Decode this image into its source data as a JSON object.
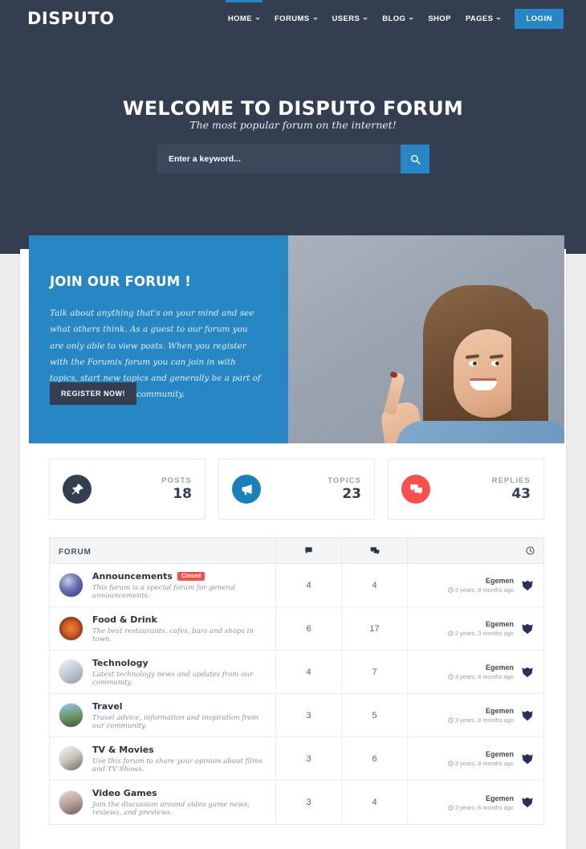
{
  "brand": "DISPUTO",
  "nav": {
    "items": [
      {
        "label": "HOME",
        "caret": true,
        "active": true
      },
      {
        "label": "FORUMS",
        "caret": true,
        "active": false
      },
      {
        "label": "USERS",
        "caret": true,
        "active": false
      },
      {
        "label": "BLOG",
        "caret": true,
        "active": false
      },
      {
        "label": "SHOP",
        "caret": false,
        "active": false
      },
      {
        "label": "PAGES",
        "caret": true,
        "active": false
      }
    ],
    "login_label": "LOGIN",
    "accent_color": "#2787c4"
  },
  "hero": {
    "title": "WELCOME TO DISPUTO FORUM",
    "subtitle": "The most popular forum on the internet!",
    "search_placeholder": "Enter a keyword...",
    "search_value": "",
    "search_icon": "search-icon",
    "background_color": "#333f51"
  },
  "join": {
    "title": "JOIN OUR FORUM !",
    "body": "Talk about anything that's on your mind and see what others think. As a guest to our forum you are only able to view posts. When you register with the Forumix forum you can join in with topics, start new topics and generally be a part of the first level of our community.",
    "button_label": "REGISTER NOW!",
    "panel_color": "#2787c4",
    "button_color": "#333f51",
    "image_alt": "woman-pointing-up-photo"
  },
  "stats": [
    {
      "label": "POSTS",
      "value": "18",
      "icon": "pin-icon",
      "color": "#333f51"
    },
    {
      "label": "TOPICS",
      "value": "23",
      "icon": "megaphone-icon",
      "color": "#1b7fba"
    },
    {
      "label": "REPLIES",
      "value": "43",
      "icon": "chat-bubbles-icon",
      "color": "#f9504e"
    }
  ],
  "forum_table": {
    "headers": {
      "forum": "FORUM",
      "topics_icon": "comment-icon",
      "replies_icon": "comments-icon",
      "last_post_icon": "clock-icon"
    },
    "rows": [
      {
        "name": "Announcements",
        "badge": "Closed",
        "description": "This forum is a special forum for general announcements.",
        "topics": "4",
        "replies": "4",
        "last_author": "Egemen",
        "last_time": "3 years, 8 months ago",
        "avatar": "announcements-avatar"
      },
      {
        "name": "Food & Drink",
        "badge": "",
        "description": "The best restaurants, cafes, bars and shops in town.",
        "topics": "6",
        "replies": "17",
        "last_author": "Egemen",
        "last_time": "2 years, 3 months ago",
        "avatar": "pizza-avatar"
      },
      {
        "name": "Technology",
        "badge": "",
        "description": "Latest technology news and updates from our community.",
        "topics": "4",
        "replies": "7",
        "last_author": "Egemen",
        "last_time": "3 years, 8 months ago",
        "avatar": "technology-avatar"
      },
      {
        "name": "Travel",
        "badge": "",
        "description": "Travel advice, information and inspiration from our community.",
        "topics": "3",
        "replies": "5",
        "last_author": "Egemen",
        "last_time": "3 years, 8 months ago",
        "avatar": "travel-avatar"
      },
      {
        "name": "TV & Movies",
        "badge": "",
        "description": "Use this forum to share your opinion about films and TV Shows.",
        "topics": "3",
        "replies": "6",
        "last_author": "Egemen",
        "last_time": "3 years, 8 months ago",
        "avatar": "tv-movies-avatar"
      },
      {
        "name": "Video Games",
        "badge": "",
        "description": "Join the discussion around video game news, reviews, and previews.",
        "topics": "3",
        "replies": "4",
        "last_author": "Egemen",
        "last_time": "3 years, 8 months ago",
        "avatar": "video-games-avatar"
      }
    ]
  }
}
